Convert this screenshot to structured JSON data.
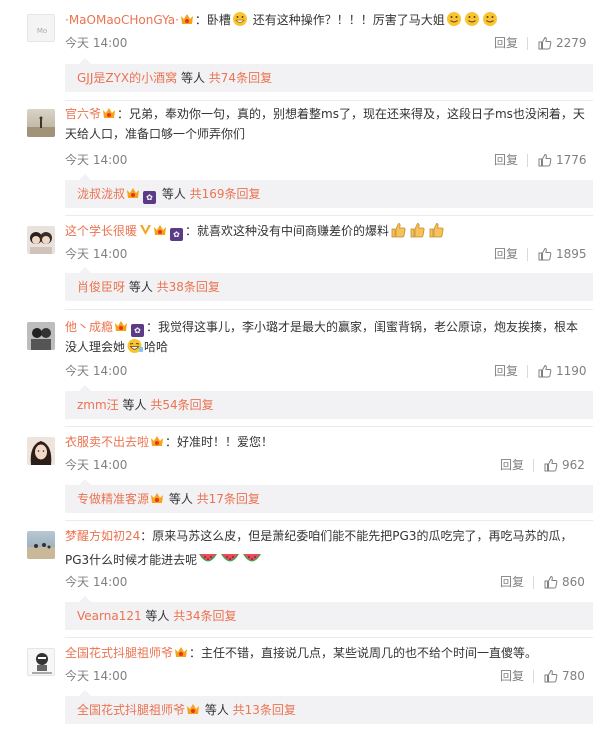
{
  "colors": {
    "name": "#eb7350",
    "meta": "#808080",
    "sub_bg": "#f2f2f5"
  },
  "comments": [
    {
      "user": "·MaOMaoCHonGYa·",
      "text_before": "：卧槽",
      "text_after": " 还有这种操作？！！！厉害了马大姐",
      "time": "今天 14:00",
      "reply": "回复",
      "likes": "2279",
      "sub_user": "GJJ是ZYX的小酒窝",
      "sub_mid": " 等人 ",
      "sub_count": "共74条回复"
    },
    {
      "user": "官六爷",
      "text_line1": "：兄弟，奉劝你一句，真的，别想着整ms了，现在还来得及，这段日子ms也没闲着，天",
      "text_line2": "天给人口，准备口够一个师弄你们",
      "time": "今天 14:00",
      "reply": "回复",
      "likes": "1776",
      "sub_user": "泷叔泷叔",
      "sub_mid": " 等人 ",
      "sub_count": "共169条回复"
    },
    {
      "user": "这个学长很暖",
      "text": "：就喜欢这种没有中间商赚差价的爆料",
      "time": "今天 14:00",
      "reply": "回复",
      "likes": "1895",
      "sub_user": "肖俊臣呀",
      "sub_mid": " 等人 ",
      "sub_count": "共38条回复"
    },
    {
      "user": "他丶成瘾",
      "text_line1": "：我觉得这事儿，李小璐才是最大的赢家，闺蜜背锅，老公原谅，炮友挨揍，根本",
      "text_line2": "没人理会她",
      "text_line2_after": "哈哈",
      "time": "今天 14:00",
      "reply": "回复",
      "likes": "1190",
      "sub_user": "zmm汪",
      "sub_mid": " 等人 ",
      "sub_count": "共54条回复"
    },
    {
      "user": "衣服卖不出去啦",
      "text": "：好准时！！爱您！",
      "time": "今天 14:00",
      "reply": "回复",
      "likes": "962",
      "sub_user": "专做精准客源",
      "sub_mid": " 等人 ",
      "sub_count": "共17条回复"
    },
    {
      "user": "梦醒方如初24",
      "text_line1": "：原来马苏这么皮，但是萧纪委咱们能不能先把PG3的瓜吃完了，再吃马苏的瓜，",
      "text_line2": "PG3什么时候才能进去呢",
      "time": "今天 14:00",
      "reply": "回复",
      "likes": "860",
      "sub_user": "Vearna121",
      "sub_mid": " 等人 ",
      "sub_count": "共34条回复"
    },
    {
      "user": "全国花式抖腿祖师爷",
      "text": "：主任不错，直接说几点，某些说周几的也不给个时间一直傻等。",
      "time": "今天 14:00",
      "reply": "回复",
      "likes": "780",
      "sub_user": "全国花式抖腿祖师爷",
      "sub_mid": " 等人 ",
      "sub_count": "共13条回复"
    }
  ]
}
